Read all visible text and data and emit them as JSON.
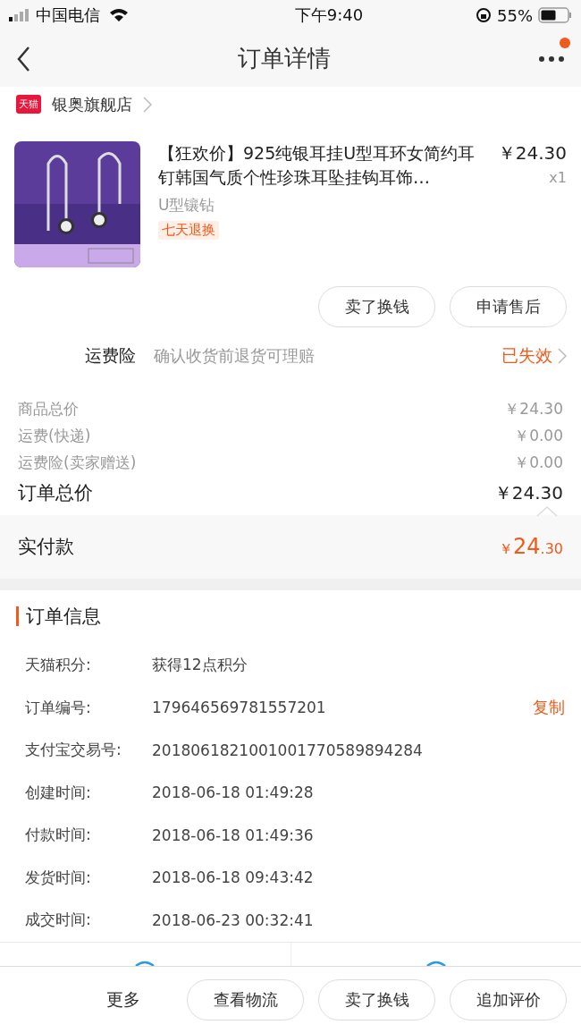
{
  "status_bar": {
    "carrier": "中国电信",
    "time": "下午9:40",
    "battery": "55%"
  },
  "nav": {
    "title": "订单详情",
    "has_notification": true
  },
  "store": {
    "name": "银奥旗舰店",
    "badge": "天猫"
  },
  "product": {
    "title": "【狂欢价】925纯银耳挂U型耳环女简约耳钉韩国气质个性珍珠耳坠挂钩耳饰…",
    "price": "￥24.30",
    "quantity": "x1",
    "sku": "U型镶钻",
    "tag": "七天退换"
  },
  "item_buttons": [
    "卖了换钱",
    "申请售后"
  ],
  "insurance": {
    "label": "运费险",
    "desc": "确认收货前退货可理赔",
    "status": "已失效"
  },
  "price_rows": [
    {
      "label": "商品总价",
      "value": "￥24.30",
      "kind": "minor"
    },
    {
      "label": "运费(快递)",
      "value": "￥0.00",
      "kind": "minor"
    },
    {
      "label": "运费险(卖家赠送)",
      "value": "￥0.00",
      "kind": "minor"
    },
    {
      "label": "订单总价",
      "value": "￥24.30",
      "kind": "total"
    }
  ],
  "paid": {
    "label": "实付款",
    "currency": "￥",
    "integer": "24",
    "decimal": ".30"
  },
  "order_info": {
    "title": "订单信息",
    "rows": [
      {
        "label": "天猫积分:",
        "value": "获得12点积分"
      },
      {
        "label": "订单编号:",
        "value": "179646569781557201",
        "action": "复制"
      },
      {
        "label": "支付宝交易号:",
        "value": "2018061821001001770589894284"
      },
      {
        "label": "创建时间:",
        "value": "2018-06-18 01:49:28"
      },
      {
        "label": "付款时间:",
        "value": "2018-06-18 01:49:36"
      },
      {
        "label": "发货时间:",
        "value": "2018-06-18 09:43:42"
      },
      {
        "label": "成交时间:",
        "value": "2018-06-23 00:32:41"
      }
    ]
  },
  "bottom_bar": {
    "more": "更多",
    "buttons": [
      "查看物流",
      "卖了换钱",
      "追加评价"
    ]
  }
}
